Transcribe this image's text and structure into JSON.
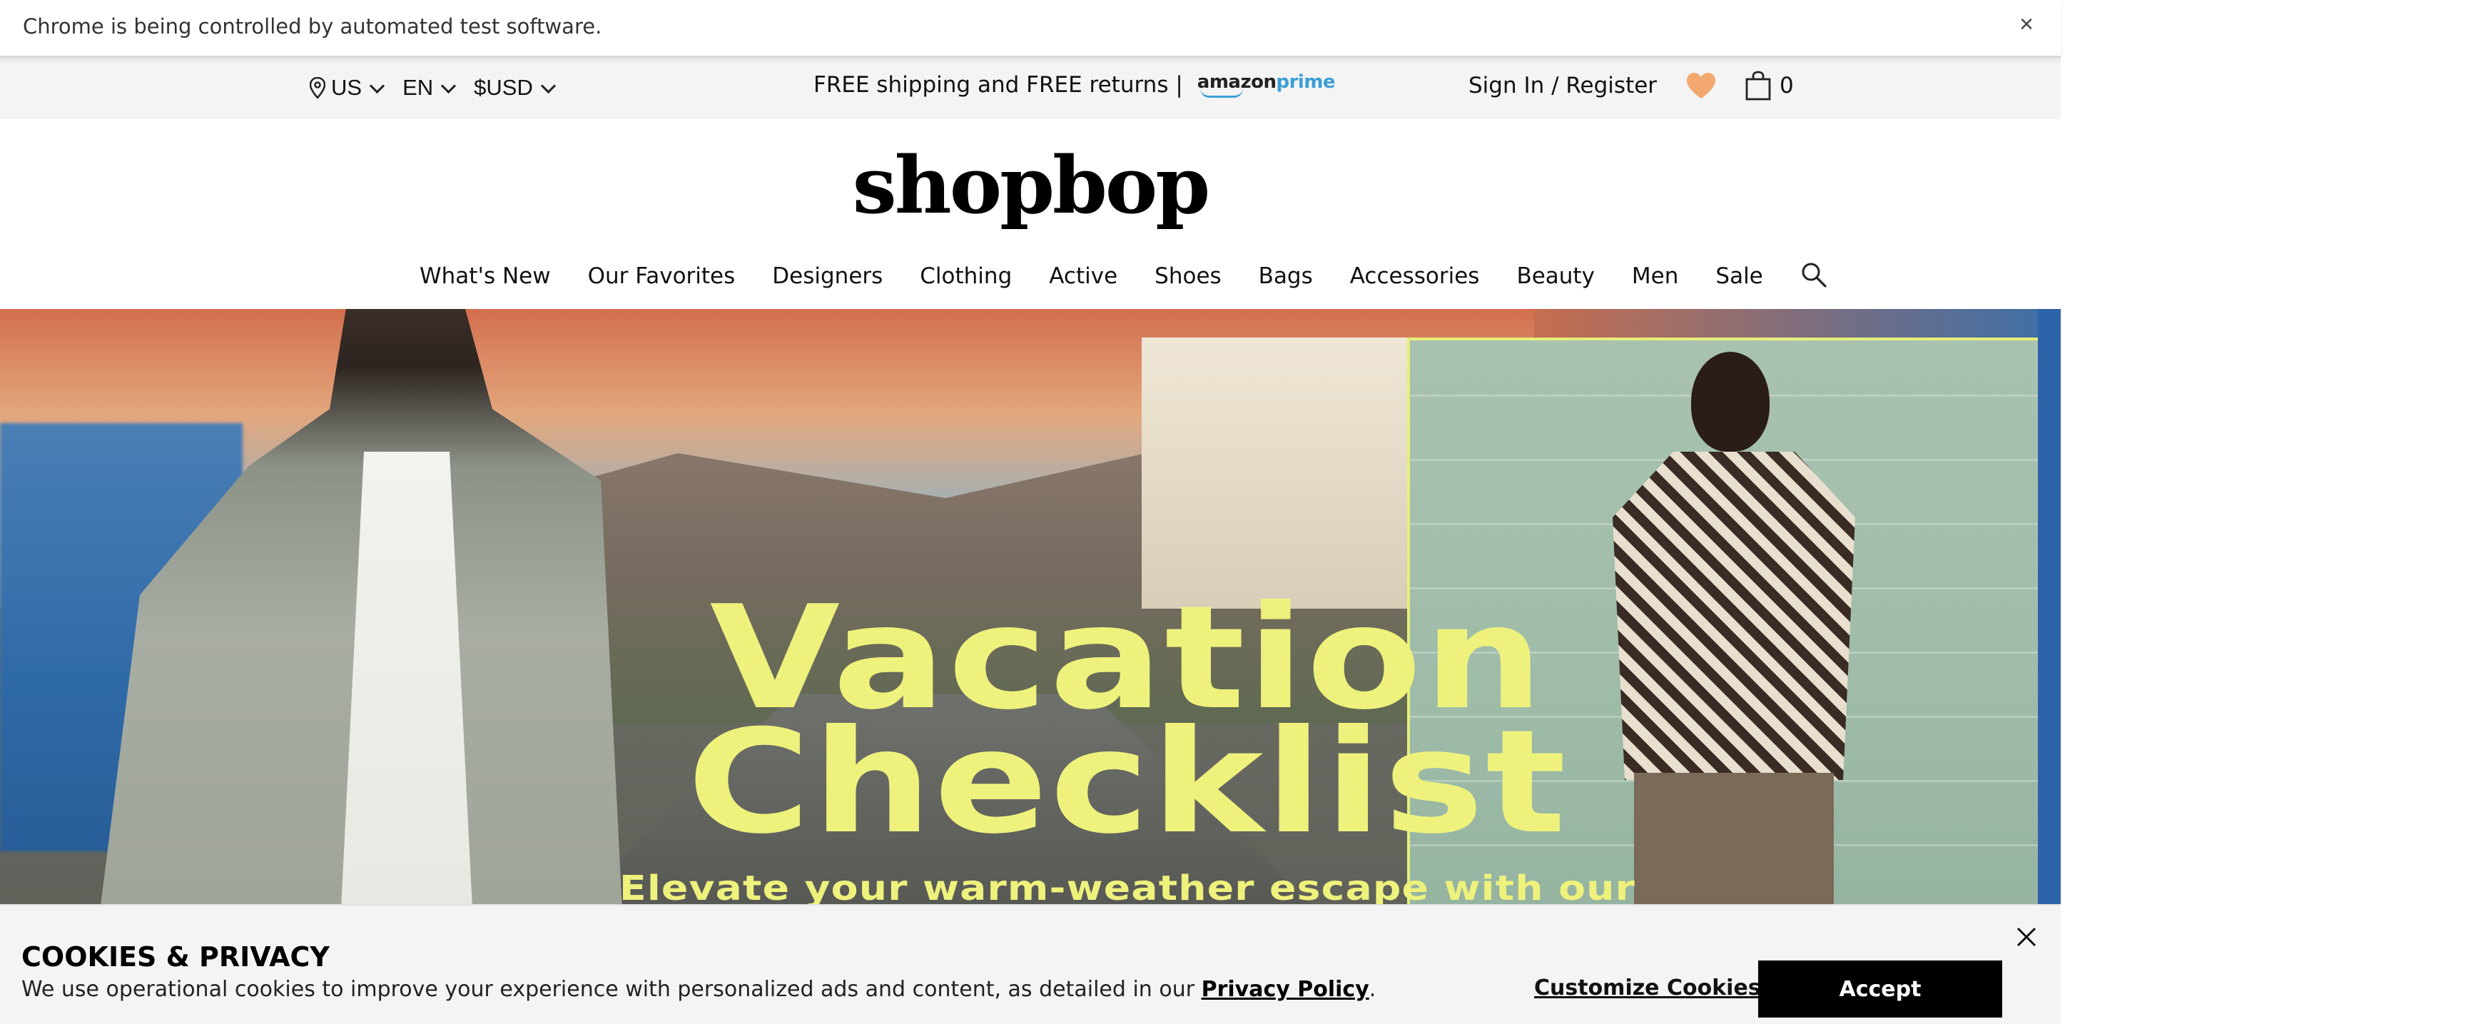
{
  "automation_bar": {
    "message": "Chrome is being controlled by automated test software.",
    "close_glyph": "×"
  },
  "utility_bar": {
    "region": "US",
    "language": "EN",
    "currency": "$USD",
    "promo_text": "FREE shipping and FREE returns |",
    "prime_logo_text_1": "amazon",
    "prime_logo_text_2": "prime",
    "signin_text": "Sign In / Register",
    "bag_count": "0",
    "icons": [
      "location-pin-icon",
      "heart-icon",
      "shopping-bag-icon"
    ],
    "heart_color": "#f2a86f"
  },
  "brand": {
    "logo_text": "shopbop"
  },
  "nav": {
    "items": [
      "What's New",
      "Our Favorites",
      "Designers",
      "Clothing",
      "Active",
      "Shoes",
      "Bags",
      "Accessories",
      "Beauty",
      "Men",
      "Sale"
    ],
    "search_icon": "search-icon"
  },
  "hero": {
    "headline_line1": "Vacation",
    "headline_line2": "Checklist",
    "subheadline": "Elevate your warm-weather escape with our latest",
    "headline_color": "#eef27c"
  },
  "cookie_banner": {
    "title": "COOKIES & PRIVACY",
    "text": "We use operational cookies to improve your experience with personalized ads and content, as detailed in our",
    "link_text": "Privacy Policy",
    "trailing_punct": ".",
    "customize_label": "Customize Cookies",
    "accept_label": "Accept",
    "close_icon": "close-icon"
  }
}
